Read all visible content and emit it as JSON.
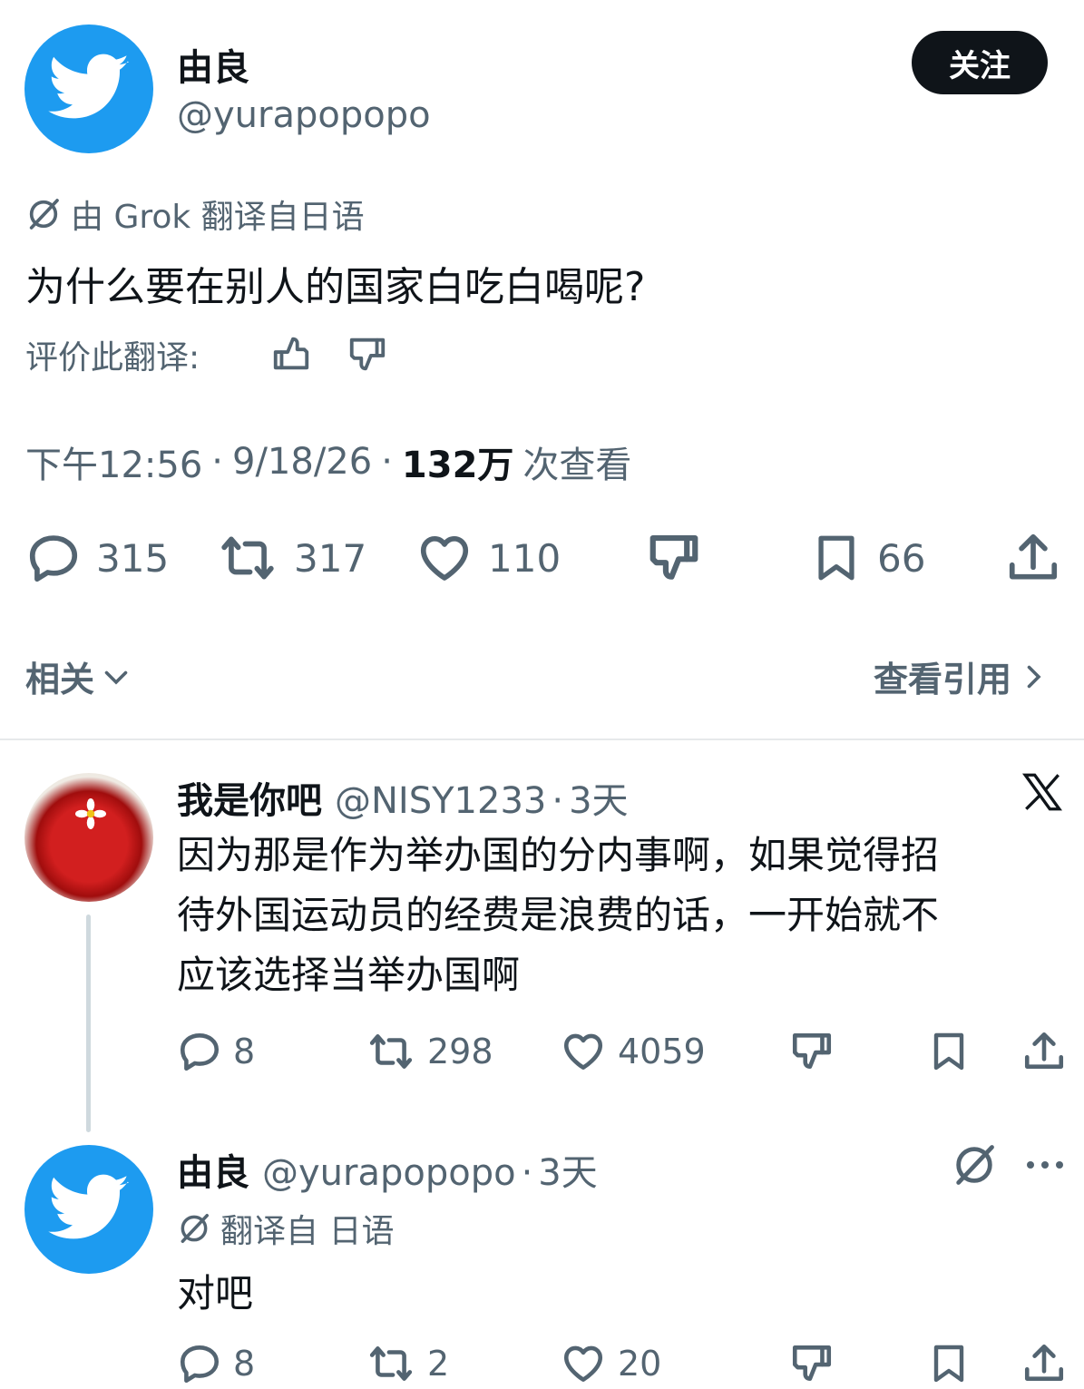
{
  "author": {
    "name": "由良",
    "handle": "@yurapopopo"
  },
  "follow_label": "关注",
  "translation": {
    "note": "由 Grok 翻译自日语",
    "text": "为什么要在别人的国家白吃白喝呢?",
    "rate_label": "评价此翻译:"
  },
  "meta": {
    "time": "下午12:56",
    "date": "9/18/26",
    "views": "132万",
    "views_suffix": "次查看",
    "sep": "·"
  },
  "stats": {
    "replies": "315",
    "retweets": "317",
    "likes": "110",
    "bookmarks": "66"
  },
  "related_label": "相关",
  "quotes_label": "查看引用",
  "reply1": {
    "name": "我是你吧",
    "handle": "@NISY1233",
    "time": "3天",
    "lines": [
      "因为那是作为举办国的分内事啊，如果觉得招",
      "待外国运动员的经费是浪费的话，一开始就不",
      "应该选择当举办国啊"
    ],
    "replies": "8",
    "retweets": "298",
    "likes": "4059"
  },
  "reply2": {
    "name": "由良",
    "handle": "@yurapopopo",
    "time": "3天",
    "translation_note": "翻译自 日语",
    "text": "对吧",
    "replies": "8",
    "retweets": "2",
    "likes": "20"
  },
  "icons": [
    "twitter-bird",
    "grok-icon",
    "thumbs-up",
    "thumbs-down",
    "reply",
    "retweet",
    "heart",
    "bookmark",
    "share",
    "x-logo",
    "more"
  ]
}
